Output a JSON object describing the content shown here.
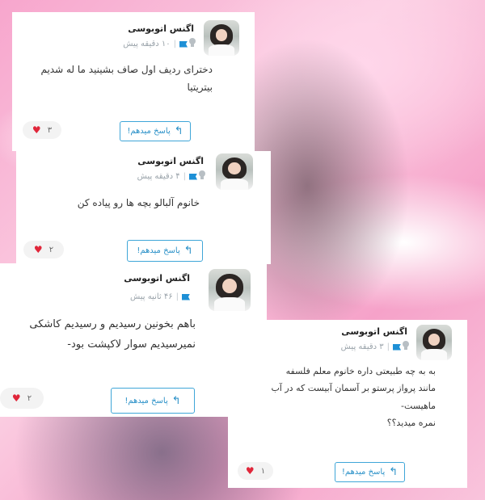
{
  "comments": [
    {
      "author": "اگنس اتوبوسی",
      "time": "۱۰ دقیقه پیش",
      "lines": [
        "دخترای ردیف اول صاف بشینید ما له شدیم",
        "بیتریتیا"
      ],
      "reply_label": "پاسخ میدهم!",
      "likes": "۳",
      "avatar_icon": "user-photo",
      "icons": [
        "pin-icon",
        "flag-icon",
        "heart-icon",
        "reply-arrow-icon"
      ]
    },
    {
      "author": "اگنس اتوبوسی",
      "time": "۴ دقیقه پیش",
      "lines": [
        "خانوم آلبالو بچه ها رو پیاده کن"
      ],
      "reply_label": "پاسخ میدهم!",
      "likes": "۲"
    },
    {
      "author": "اگنس اتوبوسی",
      "time": "۴۶ ثانیه پیش",
      "lines": [
        "باهم بخونین رسیدیم و رسیدیم کاشکی",
        "نمیرسیدیم سوار لاکپشت بود-"
      ],
      "reply_label": "پاسخ میدهم!",
      "likes": "۲"
    },
    {
      "author": "اگنس اتوبوسی",
      "time": "۳ دقیقه پیش",
      "lines": [
        "به به چه طبیعتی داره خانوم معلم فلسفه",
        "مانند پرواز پرستو بر آسمان آبیست که در آب",
        "ماهیست-",
        "نمره میدید؟؟"
      ],
      "reply_label": "پاسخ میدهم!",
      "likes": "۱"
    }
  ],
  "colors": {
    "accent": "#2b91c8",
    "heart": "#e0263a",
    "background_pink": "#f8b8d6"
  }
}
